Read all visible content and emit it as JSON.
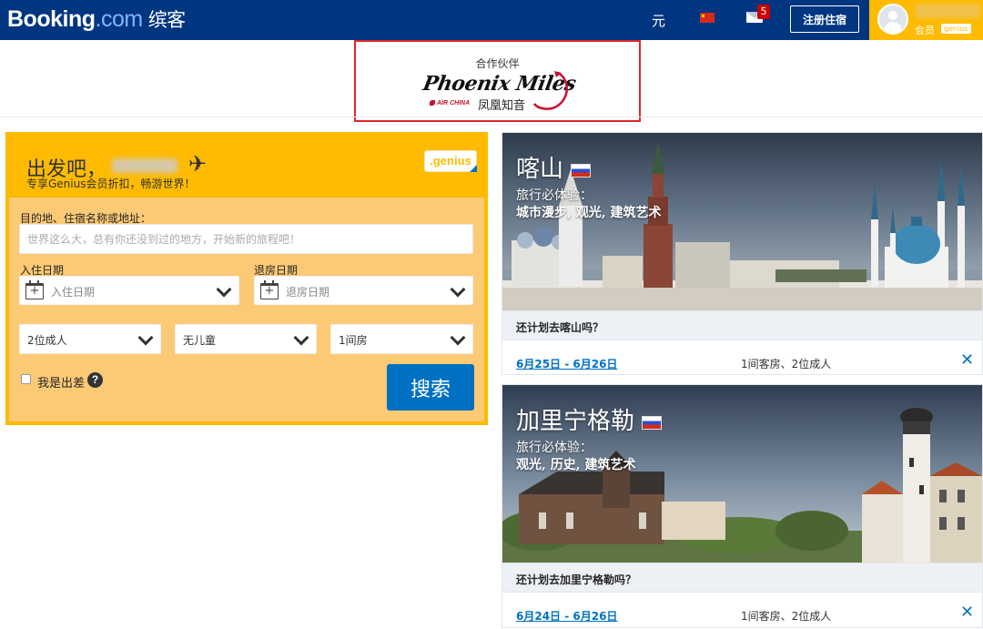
{
  "header": {
    "logo_brand": "Booking",
    "logo_suffix": ".com",
    "logo_cn": "缤客",
    "currency": "元",
    "mail_badge": "5",
    "register_button": "注册住宿",
    "member_label": "会员",
    "member_genius": "genius",
    "brand_color": "#003580",
    "accent_color": "#febb02"
  },
  "partner": {
    "label": "合作伙伴",
    "logo_script": "Phoenix Miles",
    "airline": "AIR CHINA",
    "logo_cn": "凤凰知音"
  },
  "search": {
    "title": "出发吧，",
    "subtitle": "专享Genius会员折扣，畅游世界！",
    "genius_badge": ".genius",
    "destination_label": "目的地、住宿名称或地址：",
    "destination_placeholder": "世界这么大，总有你还没到过的地方，开始新的旅程吧！",
    "checkin_label": "入住日期",
    "checkin_placeholder": "入住日期",
    "checkout_label": "退房日期",
    "checkout_placeholder": "退房日期",
    "adults": "2位成人",
    "children": "无儿童",
    "rooms": "1间房",
    "business_trip": "我是出差",
    "search_button": "搜索",
    "button_color": "#0071c2"
  },
  "destinations": [
    {
      "name": "喀山",
      "experience_label": "旅行必体验：",
      "experience_tags": "城市漫步, 观光, 建筑艺术",
      "question": "还计划去喀山吗？",
      "dates": "6月25日 - 6月26日",
      "guests": "1间客房、2位成人",
      "close": "✕"
    },
    {
      "name": "加里宁格勒",
      "experience_label": "旅行必体验：",
      "experience_tags": "观光, 历史, 建筑艺术",
      "question": "还计划去加里宁格勒吗？",
      "dates": "6月24日 - 6月26日",
      "guests": "1间客房、2位成人",
      "close": "✕"
    }
  ]
}
